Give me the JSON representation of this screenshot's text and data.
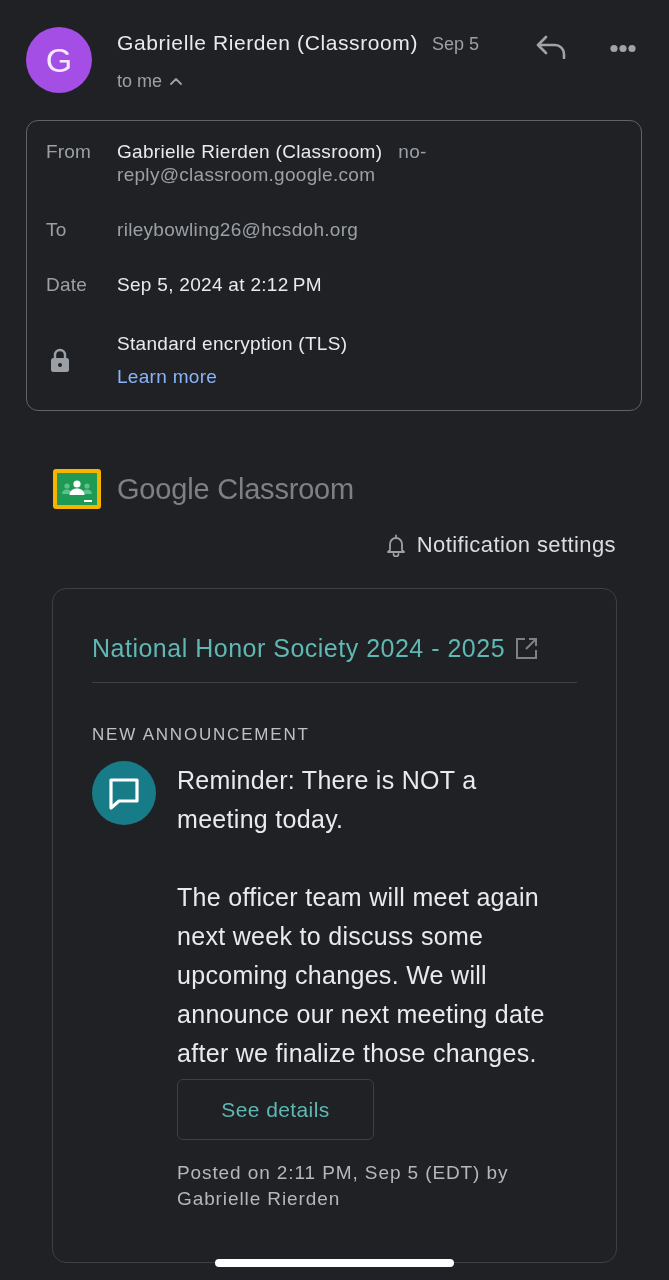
{
  "header": {
    "avatar_letter": "G",
    "sender": "Gabrielle Rierden (Classroom)",
    "date": "Sep 5",
    "recipients": "to me",
    "details_expanded": true
  },
  "details": [
    {
      "kind": "sender",
      "label": "From",
      "name": "Gabrielle Rierden (Classroom)",
      "address": "no-reply@classroom.google.com"
    },
    {
      "kind": "address",
      "label": "To",
      "value": "rileybowling26@hcsdoh.org"
    },
    {
      "kind": "text",
      "label": "Date",
      "value": "Sep 5, 2024 at 2:12 PM"
    },
    {
      "kind": "security",
      "value": "Standard encryption (TLS)",
      "link": "Learn more"
    }
  ],
  "brand": {
    "logo_text": "Google Classroom"
  },
  "notification_settings": "Notification settings",
  "announcement": {
    "class_name": "National Honor Society 2024 - 2025",
    "type_label": "NEW ANNOUNCEMENT",
    "paragraphs": [
      "Reminder: There is NOT a meeting today.",
      "The officer team will meet again next week to discuss some upcoming changes. We will announce our next meeting date after we finalize those changes."
    ],
    "button": "See details",
    "posted": "Posted on 2:11 PM, Sep 5 (EDT) by Gabrielle Rierden"
  }
}
